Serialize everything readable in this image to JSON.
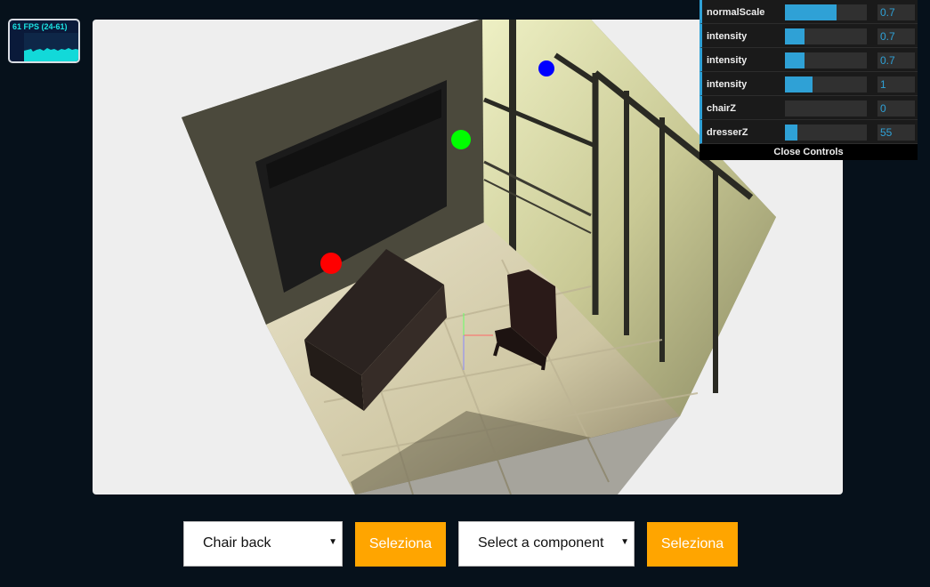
{
  "fps": {
    "label": "61 FPS (24-61)"
  },
  "controls": {
    "rows": [
      {
        "label": "normalScale",
        "value": "0.7",
        "level": 0.63
      },
      {
        "label": "intensity",
        "value": "0.7",
        "level": 0.24
      },
      {
        "label": "intensity",
        "value": "0.7",
        "level": 0.24
      },
      {
        "label": "intensity",
        "value": "1",
        "level": 0.34
      },
      {
        "label": "chairZ",
        "value": "0",
        "level": 0.0
      },
      {
        "label": "dresserZ",
        "value": "55",
        "level": 0.15
      }
    ],
    "close_label": "Close Controls"
  },
  "toolbar": {
    "select_component_value": "Chair back",
    "select_button_1": "Seleziona",
    "select_part_value": "Select a component",
    "select_button_2": "Seleziona"
  },
  "colors": {
    "accent": "#2fa1d6",
    "button": "#ffa500",
    "background": "#06111b",
    "light_red": "#ff0000",
    "light_green": "#00ff00",
    "light_blue": "#0000ff"
  }
}
